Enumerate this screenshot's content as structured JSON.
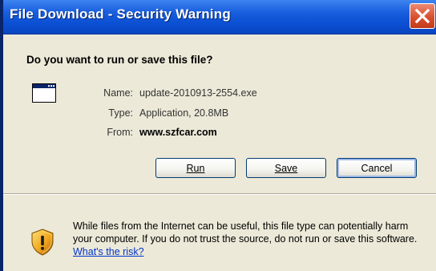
{
  "window": {
    "title": "File Download - Security Warning",
    "close_icon": "close-icon"
  },
  "prompt": {
    "question": "Do you want to run or save this file?"
  },
  "file": {
    "icon": "application-window-icon",
    "name_label": "Name:",
    "name_value": "update-2010913-2554.exe",
    "type_label": "Type:",
    "type_value": "Application, 20.8MB",
    "from_label": "From:",
    "from_value": "www.szfcar.com"
  },
  "buttons": {
    "run_label": "Run",
    "save_label": "Save",
    "cancel_label": "Cancel"
  },
  "warning": {
    "icon": "security-shield-icon",
    "text": "While files from the Internet can be useful, this file type can potentially harm your computer. If you do not trust the source, do not run or save this software.",
    "link_text": "What's the risk?"
  },
  "colors": {
    "titlebar": "#0b4fd3",
    "dialog_bg": "#ece9d8",
    "close_button": "#d8502f",
    "link": "#0033cc"
  }
}
